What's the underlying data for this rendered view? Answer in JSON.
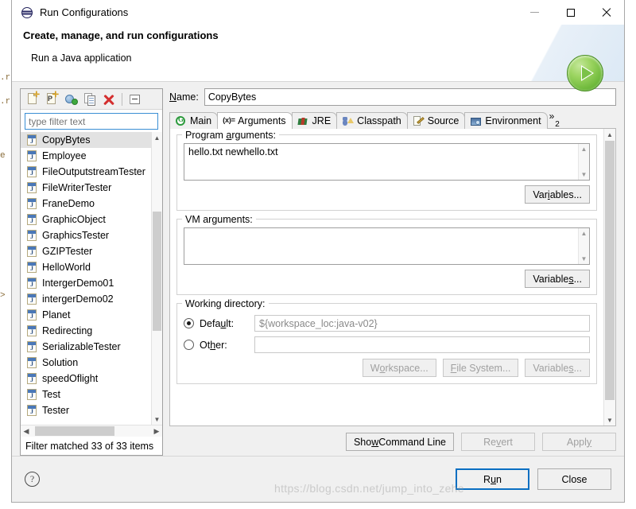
{
  "window": {
    "title": "Run Configurations",
    "icon": "eclipse-globe-icon",
    "minimize_label": "Minimize",
    "maximize_label": "Maximize",
    "close_label": "Close"
  },
  "header": {
    "title": "Create, manage, and run configurations",
    "subtitle": "Run a Java application",
    "badge_icon": "run-play-icon"
  },
  "left_panel": {
    "toolbar": [
      {
        "name": "new-configuration-icon",
        "tooltip": "New launch configuration"
      },
      {
        "name": "new-prototype-icon",
        "tooltip": "New prototype"
      },
      {
        "name": "export-configuration-icon",
        "tooltip": "Export"
      },
      {
        "name": "duplicate-configuration-icon",
        "tooltip": "Duplicate"
      },
      {
        "name": "delete-configuration-icon",
        "tooltip": "Delete"
      },
      {
        "name": "collapse-all-icon",
        "tooltip": "Collapse All"
      }
    ],
    "filter": {
      "value": "",
      "placeholder": "type filter text"
    },
    "items": [
      "CopyBytes",
      "Employee",
      "FileOutputstreamTester",
      "FileWriterTester",
      "FraneDemo",
      "GraphicObject",
      "GraphicsTester",
      "GZIPTester",
      "HelloWorld",
      "IntergerDemo01",
      "intergerDemo02",
      "Planet",
      "Redirecting",
      "SerializableTester",
      "Solution",
      "speedOflight",
      "Test",
      "Tester"
    ],
    "selected_item": "CopyBytes",
    "status": "Filter matched 33 of 33 items"
  },
  "right_panel": {
    "name_label": "Name:",
    "name_label_mnemonic": "N",
    "name_value": "CopyBytes",
    "tabs": [
      {
        "label": "Main",
        "icon": "main-tab-icon",
        "active": false
      },
      {
        "label": "Arguments",
        "icon": "arguments-tab-icon",
        "active": true
      },
      {
        "label": "JRE",
        "icon": "jre-tab-icon",
        "active": false
      },
      {
        "label": "Classpath",
        "icon": "classpath-tab-icon",
        "active": false
      },
      {
        "label": "Source",
        "icon": "source-tab-icon",
        "active": false
      },
      {
        "label": "Environment",
        "icon": "environment-tab-icon",
        "active": false
      }
    ],
    "tab_overflow": {
      "chevron": "»",
      "count": "2"
    },
    "program_arguments": {
      "label_pre": "Program ",
      "label_mnemonic": "a",
      "label_post": "rguments:",
      "value": "hello.txt newhello.txt",
      "variables_button": {
        "pre": "Var",
        "mnemonic": "i",
        "post": "ables..."
      }
    },
    "vm_arguments": {
      "label_pre": "VM ar",
      "label_mnemonic": "g",
      "label_post": "uments:",
      "value": "",
      "variables_button": {
        "pre": "Variable",
        "mnemonic": "s",
        "post": "..."
      }
    },
    "working_directory": {
      "label": "Working directory:",
      "default_radio": {
        "pre": "Defa",
        "mnemonic": "u",
        "post": "lt:",
        "selected": true,
        "value": "${workspace_loc:java-v02}"
      },
      "other_radio": {
        "pre": "Ot",
        "mnemonic": "h",
        "post": "er:",
        "selected": false,
        "value": ""
      },
      "buttons": [
        {
          "pre": "W",
          "mnemonic": "o",
          "post": "rkspace...",
          "enabled": false
        },
        {
          "pre": "",
          "mnemonic": "F",
          "post": "ile System...",
          "enabled": false
        },
        {
          "pre": "Variable",
          "mnemonic": "s",
          "post": "...",
          "enabled": false
        }
      ]
    },
    "action_buttons": [
      {
        "pre": "Show Command Line",
        "mnemonic": "",
        "post": "",
        "enabled": true,
        "name": "show-command-line-button"
      },
      {
        "pre": "Re",
        "mnemonic": "v",
        "post": "ert",
        "enabled": false,
        "name": "revert-button"
      },
      {
        "pre": "Appl",
        "mnemonic": "y",
        "post": "",
        "enabled": false,
        "name": "apply-button"
      }
    ]
  },
  "footer": {
    "help_icon": "help-question-icon",
    "run_button": {
      "pre": "R",
      "mnemonic": "u",
      "post": "n"
    },
    "close_button": {
      "pre": "Close",
      "mnemonic": "",
      "post": ""
    },
    "watermark": "https://blog.csdn.net/jump_into_zehe"
  },
  "colors": {
    "dialog_background": "#f0f0f0",
    "panel_white": "#ffffff",
    "accent_blue": "#0a6fc2",
    "filter_border": "#3a8fd4",
    "selection_gray": "#e2e2e2",
    "disabled_text": "#a0a0a0",
    "run_green": "#6db83a",
    "delete_red": "#d42f2f"
  }
}
